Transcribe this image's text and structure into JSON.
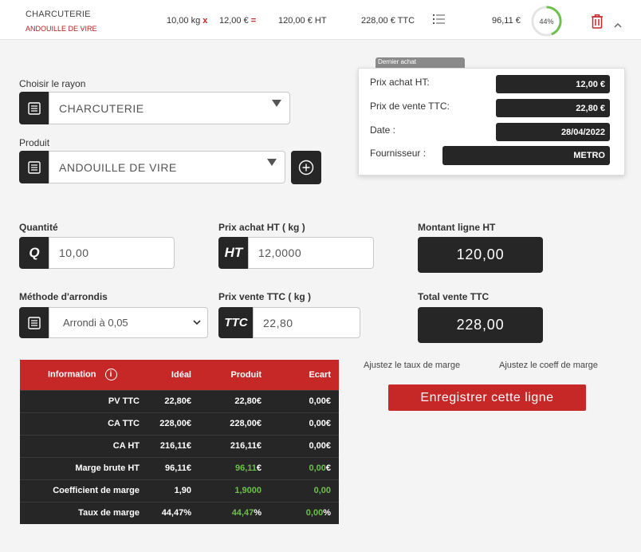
{
  "header": {
    "category": "CHARCUTERIE",
    "product": "ANDOUILLE DE VIRE",
    "qty": "10,00 kg",
    "qty_op": "x",
    "unit_price": "12,00 €",
    "unit_op": "=",
    "total_ht": "120,00 € HT",
    "total_ttc": "228,00 € TTC",
    "margin": "96,11 €",
    "margin_pct": "44%",
    "margin_fraction": 0.44
  },
  "rayon": {
    "label": "Choisir le rayon",
    "value": "CHARCUTERIE"
  },
  "produit": {
    "label": "Produit",
    "value": "ANDOUILLE DE VIRE"
  },
  "quantite": {
    "label": "Quantité",
    "prefix": "Q",
    "value": "10,00"
  },
  "prix_achat": {
    "label": "Prix achat HT ( kg )",
    "prefix": "HT",
    "value": "12,0000"
  },
  "montant_ligne": {
    "label": "Montant ligne HT",
    "value": "120,00"
  },
  "arrondi": {
    "label": "Méthode d'arrondis",
    "value": "Arrondi à 0,05"
  },
  "prix_vente": {
    "label": "Prix vente TTC ( kg )",
    "prefix": "TTC",
    "value": "22,80"
  },
  "total_vente": {
    "label": "Total vente TTC",
    "value": "228,00"
  },
  "popup": {
    "tab": "Dernier achat",
    "rows": [
      {
        "label": "Prix achat HT:",
        "value": "12,00 €"
      },
      {
        "label": "Prix de vente TTC:",
        "value": "22,80 €"
      },
      {
        "label": "Date :",
        "value": "28/04/2022"
      },
      {
        "label": "Fournisseur :",
        "value": "METRO"
      }
    ]
  },
  "table": {
    "headers": [
      "Information",
      "Idéal",
      "Produit",
      "Ecart"
    ],
    "rows": [
      {
        "label": "PV TTC",
        "ideal": "22,80€",
        "produit": "22,80€",
        "ecart": "0,00€"
      },
      {
        "label": "CA TTC",
        "ideal": "228,00€",
        "produit": "228,00€",
        "ecart": "0,00€"
      },
      {
        "label": "CA HT",
        "ideal": "216,11€",
        "produit": "216,11€",
        "ecart": "0,00€"
      },
      {
        "label": "Marge brute HT",
        "ideal": "96,11€",
        "produit": "96,11",
        "produit_unit": "€",
        "ecart": "0,00",
        "ecart_unit": "€"
      },
      {
        "label": "Coefficient de marge",
        "ideal": "1,90",
        "produit": "1,9000",
        "produit_unit": "",
        "ecart": "0,00",
        "ecart_unit": ""
      },
      {
        "label": "Taux de marge",
        "ideal": "44,47%",
        "produit": "44,47",
        "produit_unit": "%",
        "ecart": "0,00",
        "ecart_unit": "%"
      }
    ]
  },
  "actions": {
    "adjust_rate": "Ajustez le taux de marge",
    "adjust_coeff": "Ajustez le coeff de marge",
    "save": "Enregistrer cette ligne"
  },
  "colors": {
    "accent": "#c62828",
    "dark": "#262626",
    "positive": "#6cc04a"
  }
}
